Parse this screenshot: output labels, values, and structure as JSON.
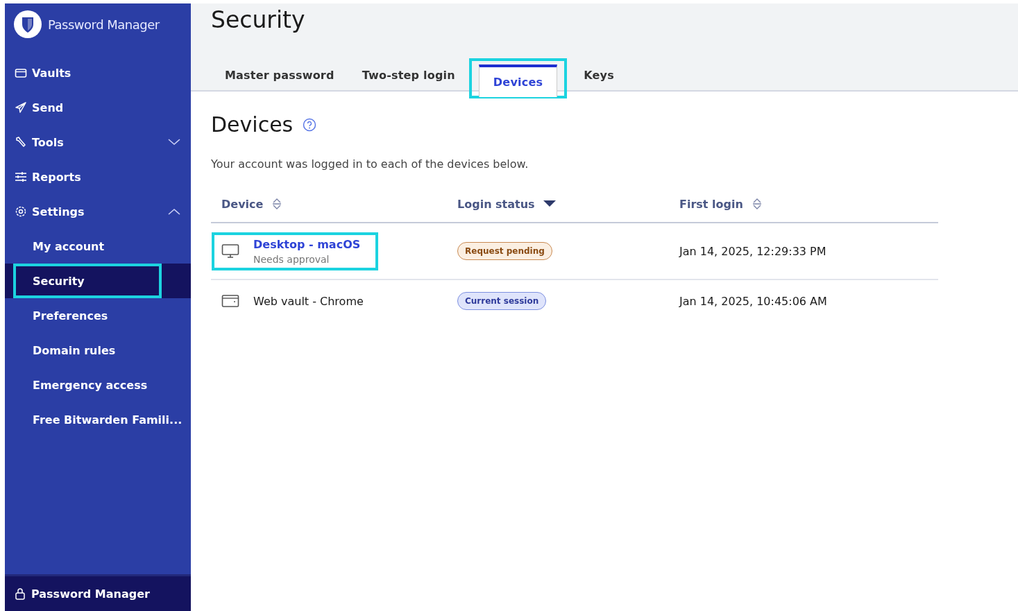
{
  "sidebar": {
    "brand": "Password Manager",
    "items": [
      {
        "label": "Vaults",
        "kind": "vault",
        "selected": false
      },
      {
        "label": "Send",
        "kind": "send",
        "selected": false
      },
      {
        "label": "Tools",
        "kind": "tools",
        "selected": false,
        "expanded": false
      },
      {
        "label": "Reports",
        "kind": "reports",
        "selected": false
      },
      {
        "label": "Settings",
        "kind": "settings",
        "selected": false,
        "expanded": true,
        "children": [
          {
            "label": "My account",
            "selected": false,
            "highlighted": false
          },
          {
            "label": "Security",
            "selected": true,
            "highlighted": true
          },
          {
            "label": "Preferences",
            "selected": false,
            "highlighted": false
          },
          {
            "label": "Domain rules",
            "selected": false,
            "highlighted": false
          },
          {
            "label": "Emergency access",
            "selected": false,
            "highlighted": false
          },
          {
            "label": "Free Bitwarden Famili...",
            "selected": false,
            "highlighted": false
          }
        ]
      }
    ],
    "footer": "Password Manager"
  },
  "page": {
    "title": "Security",
    "tabs": [
      {
        "label": "Master password",
        "selected": false,
        "highlighted": false
      },
      {
        "label": "Two-step login",
        "selected": false,
        "highlighted": false
      },
      {
        "label": "Devices",
        "selected": true,
        "highlighted": true
      },
      {
        "label": "Keys",
        "selected": false,
        "highlighted": false
      }
    ],
    "heading": "Devices",
    "description": "Your account was logged in to each of the devices below.",
    "table": {
      "columns": [
        {
          "label": "Device",
          "sorted": false
        },
        {
          "label": "Login status",
          "sorted": true
        },
        {
          "label": "First login",
          "sorted": false
        }
      ],
      "rows": [
        {
          "device": "Desktop - macOS",
          "subtitle": "Needs approval",
          "kind": "desktop",
          "link": true,
          "highlighted": true,
          "status": {
            "text": "Request pending",
            "kind": "pending"
          },
          "first_login": "Jan 14, 2025, 12:29:33 PM"
        },
        {
          "device": "Web vault - Chrome",
          "kind": "browser",
          "link": false,
          "highlighted": false,
          "status": {
            "text": "Current session",
            "kind": "current"
          },
          "first_login": "Jan 14, 2025, 10:45:06 AM"
        }
      ]
    }
  }
}
